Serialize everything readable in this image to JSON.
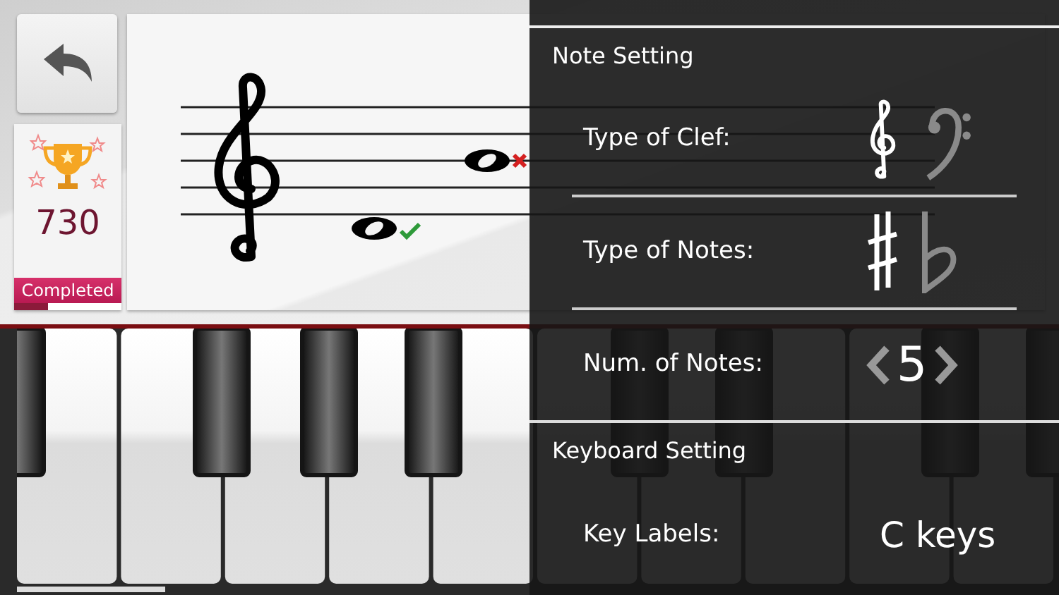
{
  "score": {
    "value": "730",
    "label": "Completed",
    "level": 0.32
  },
  "staff": {
    "notes": [
      {
        "correct": true
      },
      {
        "correct": false
      }
    ]
  },
  "settings": {
    "sections": [
      {
        "title": "Note Setting",
        "rows": [
          {
            "kind": "choice",
            "label": "Type of Clef:",
            "options": [
              {
                "selected": true
              },
              {
                "selected": false
              }
            ]
          },
          {
            "kind": "choice",
            "label": "Type of Notes:",
            "options": [
              {
                "selected": true
              },
              {
                "selected": false
              }
            ]
          },
          {
            "kind": "stepper",
            "label": "Num. of Notes:",
            "value": "5"
          }
        ]
      },
      {
        "title": "Keyboard Setting",
        "rows": [
          {
            "kind": "value",
            "label": "Key Labels:",
            "value": "C keys"
          }
        ]
      }
    ]
  }
}
